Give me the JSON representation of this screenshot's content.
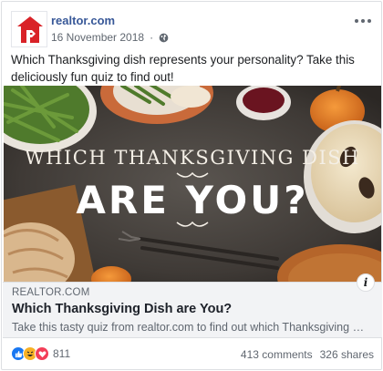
{
  "post": {
    "page_name": "realtor.com",
    "timestamp": "16 November 2018",
    "separator": "·",
    "privacy_icon": "globe-icon",
    "more_icon": "ellipsis-icon",
    "text": "Which Thanksgiving dish represents your personality? Take this deliciously fun quiz to find out!"
  },
  "image": {
    "line1": "WHICH THANKSGIVING DISH",
    "line2": "ARE YOU?"
  },
  "link": {
    "domain": "REALTOR.COM",
    "title": "Which Thanksgiving Dish are You?",
    "description": "Take this tasty quiz from realtor.com to find out which Thanksgiving dish y...",
    "info_icon": "i"
  },
  "reactions": {
    "icons": [
      "like-icon",
      "haha-icon",
      "love-icon"
    ],
    "count": "811",
    "comments": "413 comments",
    "shares": "326 shares"
  },
  "colors": {
    "brand": "#d92228",
    "link_blue": "#385898",
    "like": "#1877f2",
    "love": "#f33e58",
    "haha": "#f7b125"
  }
}
